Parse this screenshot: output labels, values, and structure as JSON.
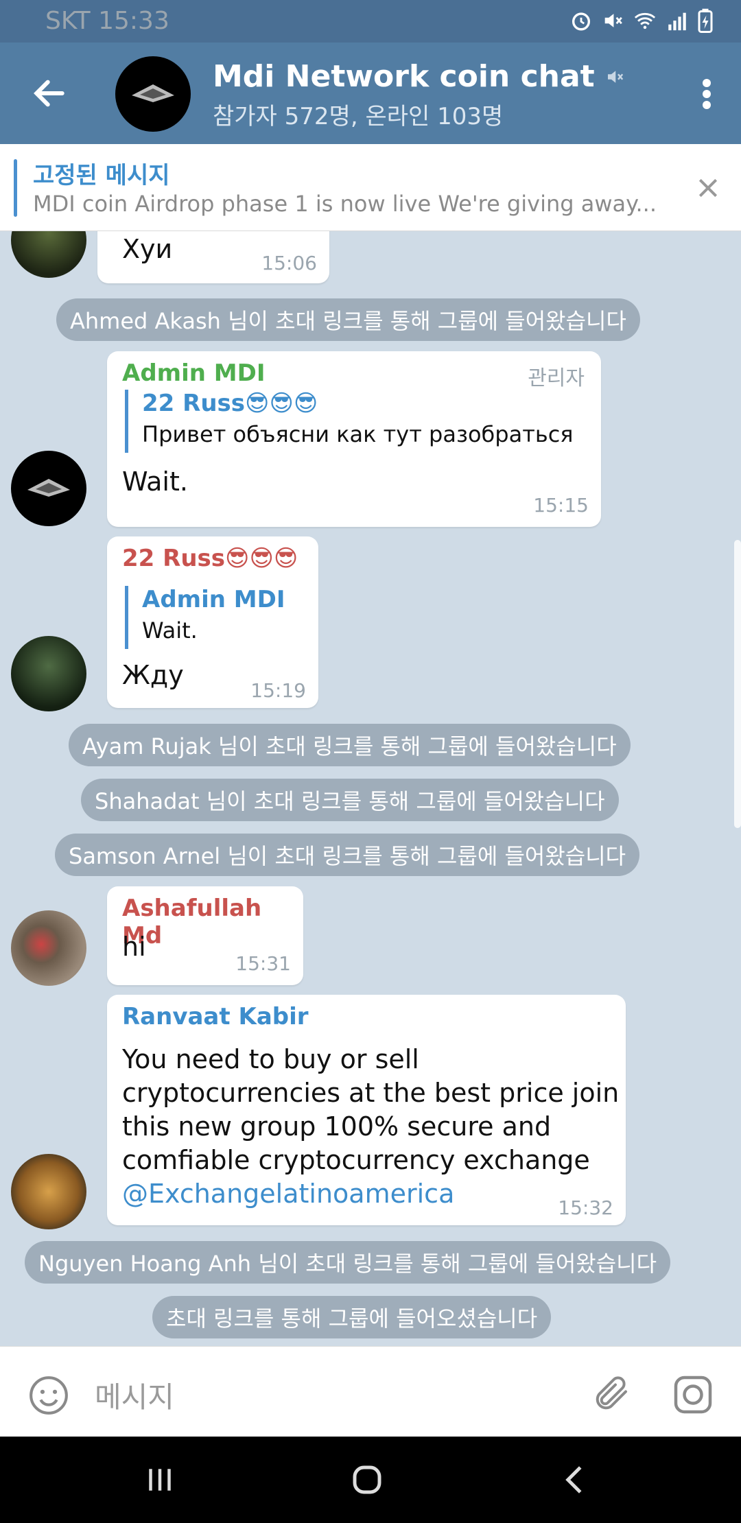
{
  "statusbar": {
    "carrier_time": "SKT 15:33"
  },
  "header": {
    "title": "Mdi Network coin chat",
    "subtitle": "참가자 572명, 온라인 103명"
  },
  "pinned": {
    "title": "고정된 메시지",
    "message": "MDI coin Airdrop phase 1 is now live We're giving away..."
  },
  "messages": {
    "m1": {
      "text": "Хуи",
      "time": "15:06"
    },
    "svc1": "Ahmed Akash 님이 초대 링크를 통해 그룹에 들어왔습니다",
    "m2": {
      "sender": "Admin MDI",
      "badge": "관리자",
      "reply_name": "22 Russ😎😎😎",
      "reply_text": "Привет объясни как тут разобраться",
      "text": "Wait.",
      "time": "15:15"
    },
    "m3": {
      "sender": "22 Russ😎😎😎",
      "reply_name": "Admin MDI",
      "reply_text": "Wait.",
      "text": "Жду",
      "time": "15:19"
    },
    "svc2": "Ayam Rujak 님이 초대 링크를 통해 그룹에 들어왔습니다",
    "svc3": "Shahadat 님이 초대 링크를 통해 그룹에 들어왔습니다",
    "svc4": "Samson Arnel 님이 초대 링크를 통해 그룹에 들어왔습니다",
    "m4": {
      "sender": "Ashafullah Md",
      "text": "hi",
      "time": "15:31"
    },
    "m5": {
      "sender": "Ranvaat Kabir",
      "line1": "You need to buy or sell",
      "line2": "cryptocurrencies at the best price join",
      "line3": "this new group 100% secure and",
      "line4": "comfiable cryptocurrency exchange",
      "link": "@Exchangelatinoamerica",
      "time": "15:32"
    },
    "svc5": "Nguyen Hoang Anh 님이 초대 링크를 통해 그룹에 들어왔습니다",
    "svc6": "초대 링크를 통해 그룹에 들어오셨습니다"
  },
  "input": {
    "placeholder": "메시지"
  },
  "colors": {
    "header": "#527da3",
    "sender_green": "#4fae4e",
    "sender_red": "#c8524e",
    "sender_blue": "#3d8dcc",
    "link": "#3d8dcc"
  }
}
